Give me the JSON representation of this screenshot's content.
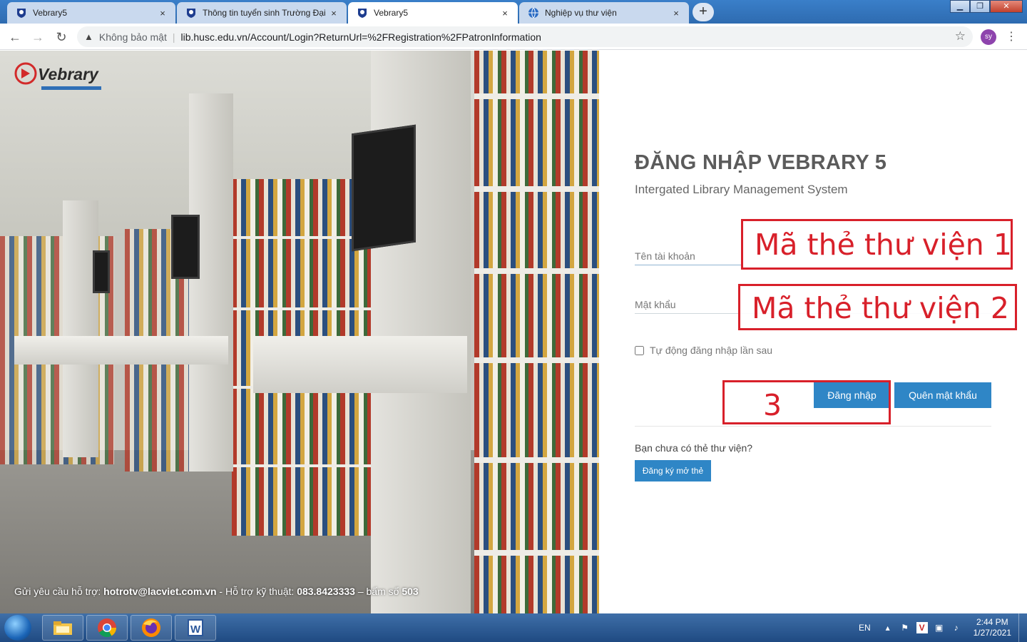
{
  "browser": {
    "tabs": [
      {
        "title": "Vebrary5",
        "active": false
      },
      {
        "title": "Thông tin tuyển sinh Trường Đại",
        "active": false
      },
      {
        "title": "Vebrary5",
        "active": true
      },
      {
        "title": "Nghiệp vụ thư viện",
        "active": false
      }
    ],
    "tab_close_glyph": "×",
    "new_tab_glyph": "+",
    "security_label": "Không bảo mật",
    "url": "lib.husc.edu.vn/Account/Login?ReturnUrl=%2FRegistration%2FPatronInformation",
    "profile_initials": "sy",
    "profile_color": "#8e44ad"
  },
  "hero": {
    "support_prefix": "Gửi yêu cầu hỗ trợ: ",
    "support_email": "hotrotv@lacviet.com.vn",
    "support_mid": " - Hỗ trợ kỹ thuật: ",
    "support_phone": "083.8423333",
    "support_dash": " – bấm số ",
    "support_ext": "503"
  },
  "login": {
    "title": "ĐĂNG NHẬP VEBRARY 5",
    "subtitle": "Intergated Library Management System",
    "username_placeholder": "Tên tài khoản",
    "password_placeholder": "Mật khẩu",
    "remember_label": "Tự động đăng nhập lần sau",
    "login_button": "Đăng nhập",
    "forgot_button": "Quên mật khẩu",
    "no_card_text": "Bạn chưa có thẻ thư viện?",
    "register_button": "Đăng ký mở thẻ",
    "accent_color": "#2f86c6"
  },
  "annotations": {
    "box1": "Mã thẻ thư viện 1",
    "box2": "Mã thẻ thư viện  2",
    "box3": "3",
    "color": "#d8202a"
  },
  "taskbar": {
    "language": "EN",
    "time": "2:44 PM",
    "date": "1/27/2021",
    "apps": [
      "file-explorer-icon",
      "chrome-icon",
      "firefox-icon",
      "word-icon"
    ]
  }
}
